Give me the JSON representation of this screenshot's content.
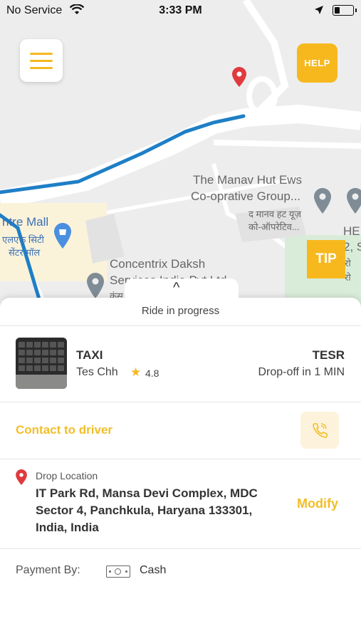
{
  "status_bar": {
    "carrier": "No Service",
    "time": "3:33 PM"
  },
  "map": {
    "labels": {
      "manav_line1": "The Manav Hut Ews",
      "manav_line2": "Co-oprative Group...",
      "manav_hindi1": "द मानव हट यूज़",
      "manav_hindi2": "को-ऑपरेटिव...",
      "mall": "ntre Mall",
      "mall_hindi1": "एलएफ सिटी",
      "mall_hindi2": "सेंटर मॉल",
      "concentrix1": "Concentrix Daksh",
      "concentrix2": "Services India Pvt Ltd",
      "concentrix_hindi": "कंस",
      "he": "HE",
      "edge2": "2, S",
      "edge3": "रो",
      "edge4": "रो"
    }
  },
  "buttons": {
    "help": "HELP",
    "tip": "TIP"
  },
  "ride": {
    "status": "Ride in progress",
    "chevron": "^",
    "vehicle_type": "TAXI",
    "driver_name": "Tes Chh",
    "rating": "4.8",
    "plate": "TESR",
    "eta": "Drop-off in 1 MIN"
  },
  "contact": {
    "label": "Contact to driver"
  },
  "drop": {
    "label": "Drop Location",
    "address": "IT Park Rd, Mansa Devi Complex, MDC Sector 4, Panchkula, Haryana 133301, India, India",
    "modify": "Modify"
  },
  "payment": {
    "label": "Payment By:",
    "method": "Cash"
  },
  "colors": {
    "accent": "#f7b81e",
    "route": "#1e7fc6",
    "pin_red": "#e03a3e"
  }
}
